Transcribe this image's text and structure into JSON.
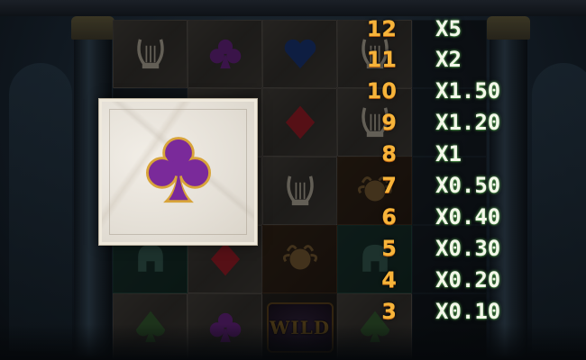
{
  "symbol_card": {
    "symbol": "club-purple",
    "color": "#7a2a9a",
    "trim": "#d8a43a"
  },
  "paytable": {
    "count_color": "#f7b43a",
    "multiplier_color": "#f4f7ea",
    "rows": [
      {
        "count": "12",
        "multiplier": "X5"
      },
      {
        "count": "11",
        "multiplier": "X2"
      },
      {
        "count": "10",
        "multiplier": "X1.50"
      },
      {
        "count": "9",
        "multiplier": "X1.20"
      },
      {
        "count": "8",
        "multiplier": "X1"
      },
      {
        "count": "7",
        "multiplier": "X0.50"
      },
      {
        "count": "6",
        "multiplier": "X0.40"
      },
      {
        "count": "5",
        "multiplier": "X0.30"
      },
      {
        "count": "4",
        "multiplier": "X0.20"
      },
      {
        "count": "3",
        "multiplier": "X0.10"
      }
    ]
  },
  "grid": {
    "wild_label": "WILD"
  }
}
